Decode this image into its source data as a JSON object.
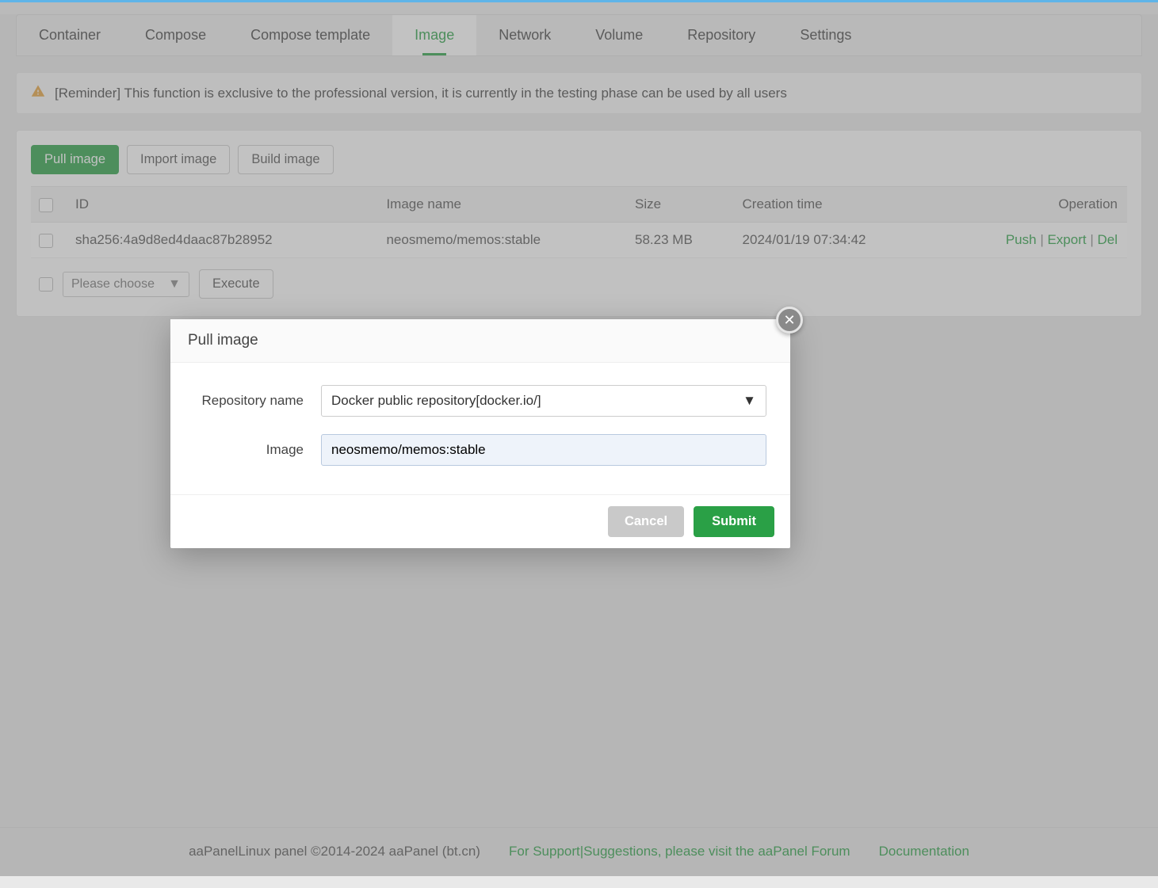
{
  "tabs": [
    "Container",
    "Compose",
    "Compose template",
    "Image",
    "Network",
    "Volume",
    "Repository",
    "Settings"
  ],
  "active_tab_index": 3,
  "reminder": "[Reminder] This function is exclusive to the professional version, it is currently in the testing phase can be used by all users",
  "buttons": {
    "pull": "Pull image",
    "import": "Import image",
    "build": "Build image"
  },
  "table": {
    "headers": [
      "ID",
      "Image name",
      "Size",
      "Creation time",
      "Operation"
    ],
    "rows": [
      {
        "id": "sha256:4a9d8ed4daac87b28952",
        "name": "neosmemo/memos:stable",
        "size": "58.23 MB",
        "created": "2024/01/19 07:34:42"
      }
    ],
    "op": {
      "push": "Push",
      "export": "Export",
      "del": "Del"
    }
  },
  "batch": {
    "placeholder": "Please choose",
    "execute": "Execute"
  },
  "modal": {
    "title": "Pull image",
    "repo_label": "Repository name",
    "repo_value": "Docker public repository[docker.io/]",
    "image_label": "Image",
    "image_value": "neosmemo/memos:stable",
    "cancel": "Cancel",
    "submit": "Submit"
  },
  "footer": {
    "copyright": "aaPanelLinux panel ©2014-2024 aaPanel (bt.cn)",
    "forum": "For Support|Suggestions, please visit the aaPanel Forum",
    "doc": "Documentation"
  }
}
